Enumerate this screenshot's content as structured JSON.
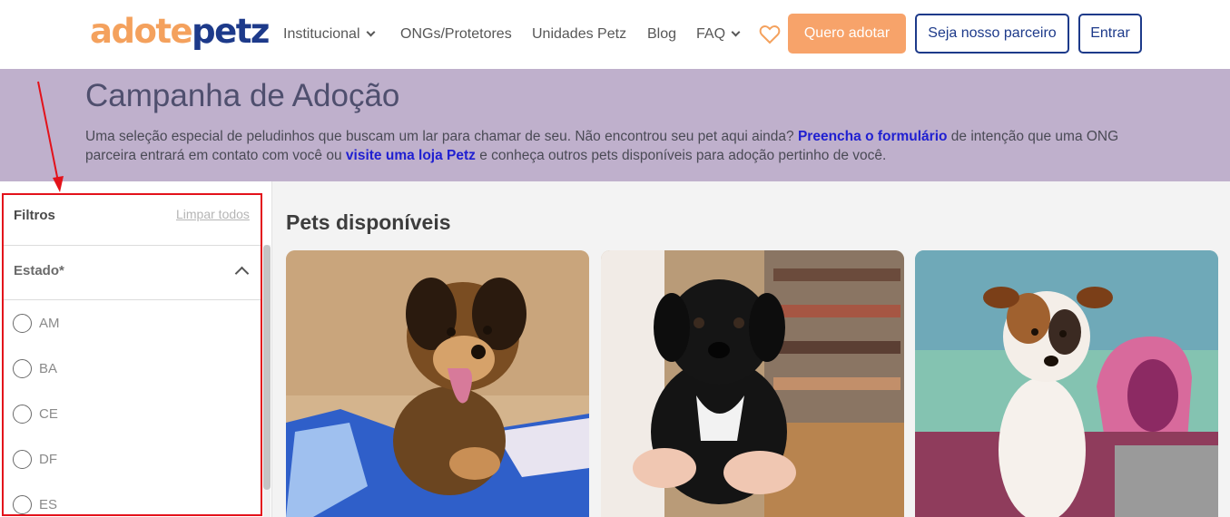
{
  "header": {
    "logo_part1": "adote",
    "logo_part2": "petz",
    "nav": [
      {
        "label": "Institucional",
        "has_dropdown": true
      },
      {
        "label": "ONGs/Protetores",
        "has_dropdown": false
      },
      {
        "label": "Unidades Petz",
        "has_dropdown": false
      },
      {
        "label": "Blog",
        "has_dropdown": false
      },
      {
        "label": "FAQ",
        "has_dropdown": true
      }
    ],
    "favorites_icon": "heart-icon",
    "cta_adopt": "Quero adotar",
    "cta_partner": "Seja nosso parceiro",
    "cta_login": "Entrar"
  },
  "banner": {
    "title": "Campanha de Adoção",
    "text_part1": "Uma seleção especial de peludinhos que buscam um lar para chamar de seu. Não encontrou seu pet aqui ainda? ",
    "link1": "Preencha o formulário",
    "text_part2": " de intenção que uma ONG parceira entrará em contato com você ou ",
    "link2": "visite uma loja Petz",
    "text_part3": " e conheça outros pets disponíveis para adoção pertinho de você."
  },
  "filters": {
    "title": "Filtros",
    "clear_label": "Limpar todos",
    "state_title": "Estado*",
    "states": [
      "AM",
      "BA",
      "CE",
      "DF",
      "ES"
    ]
  },
  "pets": {
    "title": "Pets disponíveis"
  },
  "colors": {
    "brand_orange": "#f4a15d",
    "brand_blue": "#1d3a8a",
    "banner_bg": "#bfb0cc",
    "annotation_red": "#e3121b"
  }
}
